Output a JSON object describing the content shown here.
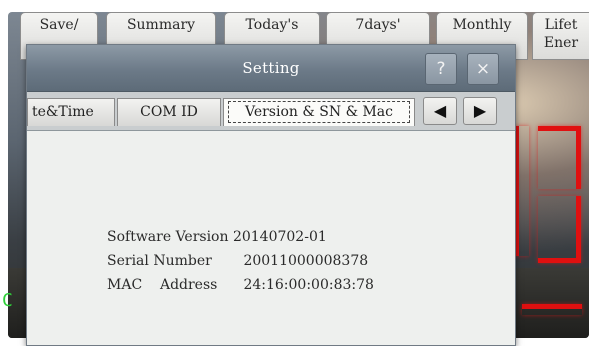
{
  "top_tabs": [
    {
      "label": "Save/"
    },
    {
      "label": "Summary"
    },
    {
      "label": "Today's"
    },
    {
      "label": "7days'"
    },
    {
      "label": "Monthly"
    },
    {
      "label_line1": "Lifet",
      "label_line2": "Ener"
    }
  ],
  "dialog": {
    "title": "Setting",
    "help_symbol": "?",
    "close_symbol": "×",
    "tabs": [
      {
        "label": "te&Time"
      },
      {
        "label": "COM ID"
      },
      {
        "label": "Version & SN & Mac",
        "active": true
      }
    ],
    "prev_arrow": "◀",
    "next_arrow": "▶",
    "info": {
      "software_version": {
        "label": "Software Version",
        "value": "20140702-01"
      },
      "serial_number": {
        "label": "Serial Number",
        "value": "20011000008378"
      },
      "mac_address": {
        "label": "MAC    Address",
        "value": "24:16:00:00:83:78"
      }
    }
  },
  "background": {
    "status_digit": "C",
    "accent_red": "#e01010",
    "accent_green": "#2fd03a"
  }
}
